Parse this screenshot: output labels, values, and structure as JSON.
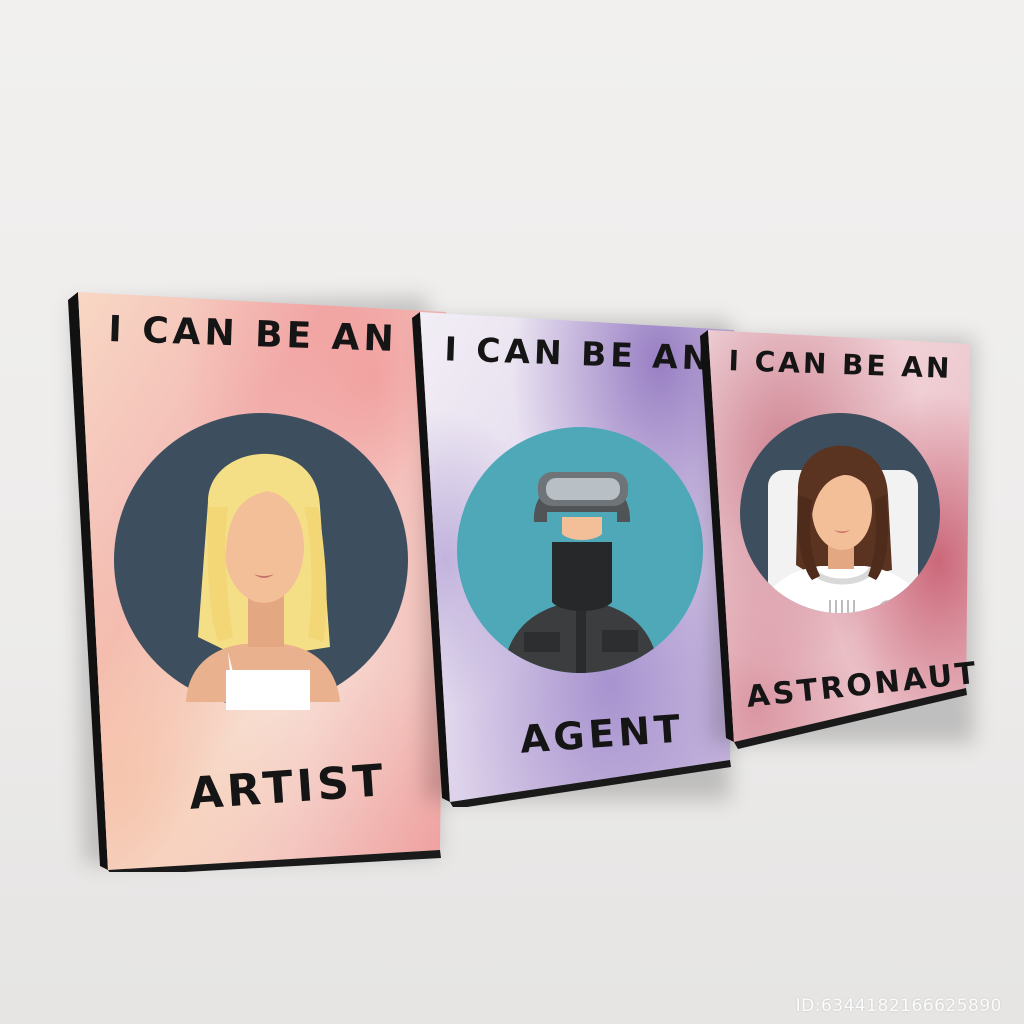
{
  "posters": [
    {
      "title": "I CAN BE AN",
      "caption": "ARTIST",
      "circle_color": "#3d4f5e",
      "background_colors": [
        "#f8d8c6",
        "#f1a7a8",
        "#f9e8dc"
      ],
      "figure": "blonde woman in white tank top"
    },
    {
      "title": "I CAN BE AN",
      "caption": "AGENT",
      "circle_color": "#4ea8b8",
      "background_colors": [
        "#ede8f2",
        "#a18ac4",
        "#f5f2f7"
      ],
      "figure": "agent with helmet, goggles and face mask"
    },
    {
      "title": "I CAN BE AN",
      "caption": "ASTRONAUT",
      "circle_color": "#3d4f5e",
      "background_colors": [
        "#f3dce0",
        "#c66d7d",
        "#f8eef0"
      ],
      "figure": "brunette woman in white spacesuit"
    }
  ],
  "watermark": "ID:6344182166625890"
}
